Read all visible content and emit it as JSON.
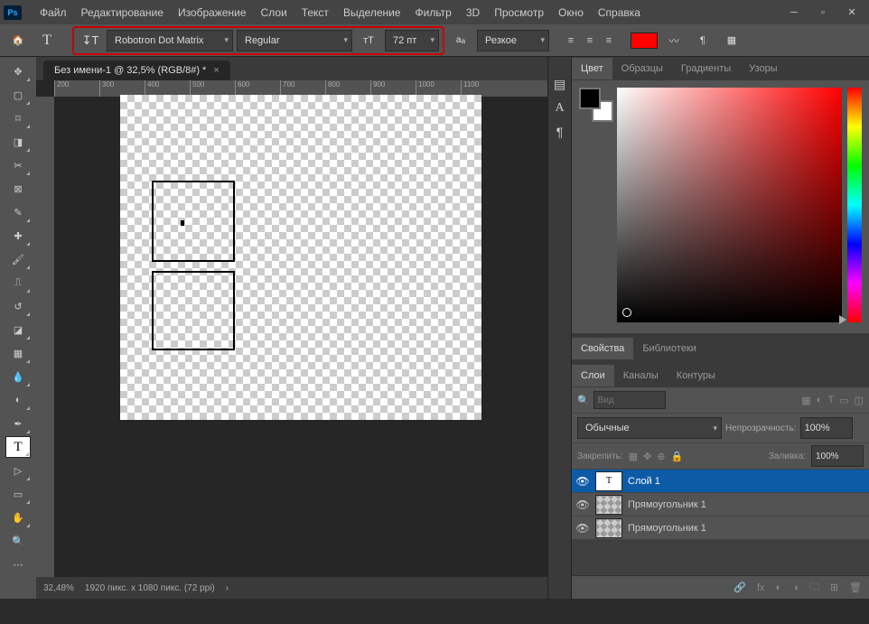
{
  "app": {
    "logo": "Ps"
  },
  "menu": [
    "Файл",
    "Редактирование",
    "Изображение",
    "Слои",
    "Текст",
    "Выделение",
    "Фильтр",
    "3D",
    "Просмотр",
    "Окно",
    "Справка"
  ],
  "options": {
    "font_family": "Robotron Dot Matrix",
    "font_style": "Regular",
    "font_size": "72 пт",
    "antialias": "Резкое",
    "color": "#ff0000"
  },
  "document": {
    "tab_title": "Без имени-1 @ 32,5% (RGB/8#) *",
    "ruler_ticks": [
      "200",
      "300",
      "400",
      "500",
      "600",
      "700",
      "800",
      "900",
      "1000",
      "1100"
    ]
  },
  "panels": {
    "color_tabs": [
      "Цвет",
      "Образцы",
      "Градиенты",
      "Узоры"
    ],
    "props_tabs": [
      "Свойства",
      "Библиотеки"
    ],
    "layers_tabs": [
      "Слои",
      "Каналы",
      "Контуры"
    ]
  },
  "layers": {
    "search_hint": "Вид",
    "blend_mode": "Обычные",
    "opacity_label": "Непрозрачность:",
    "opacity_value": "100%",
    "lock_label": "Закрепить:",
    "fill_label": "Заливка:",
    "fill_value": "100%",
    "items": [
      {
        "name": "Слой 1",
        "type": "text"
      },
      {
        "name": "Прямоугольник 1",
        "type": "shape"
      },
      {
        "name": "Прямоугольник 1",
        "type": "shape"
      }
    ]
  },
  "status": {
    "zoom": "32,48%",
    "doc_info": "1920 пикс. x 1080 пикс. (72 ppi)"
  }
}
